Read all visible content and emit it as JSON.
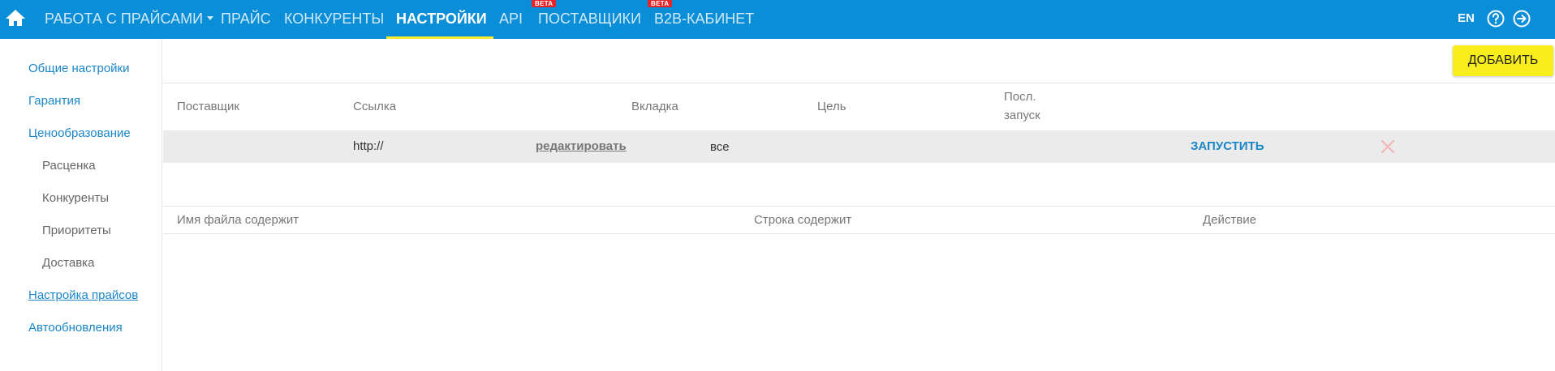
{
  "nav": {
    "items": [
      {
        "label": "РАБОТА С ПРАЙСАМИ"
      },
      {
        "label": "ПРАЙС"
      },
      {
        "label": "КОНКУРЕНТЫ"
      },
      {
        "label": "НАСТРОЙКИ"
      },
      {
        "label": "API"
      },
      {
        "label": "ПОСТАВЩИКИ"
      },
      {
        "label": "B2B-КАБИНЕТ"
      }
    ],
    "beta_label": "BETA",
    "lang": "EN"
  },
  "sidebar": {
    "items": [
      {
        "label": "Общие настройки"
      },
      {
        "label": "Гарантия"
      },
      {
        "label": "Ценообразование"
      },
      {
        "label": "Расценка"
      },
      {
        "label": "Конкуренты"
      },
      {
        "label": "Приоритеты"
      },
      {
        "label": "Доставка"
      },
      {
        "label": "Настройка прайсов"
      },
      {
        "label": "Автообновления"
      }
    ]
  },
  "toolbar": {
    "add_label": "ДОБАВИТЬ"
  },
  "table": {
    "headers": [
      "Поставщик",
      "Ссылка",
      "Вкладка",
      "Цель",
      "Посл.",
      "запуск"
    ],
    "rows": [
      {
        "supplier": "",
        "link": "http://",
        "edit": "редактировать",
        "tab": "все",
        "run": "ЗАПУСТИТЬ"
      }
    ]
  },
  "rules_table": {
    "headers": [
      "Имя файла содержит",
      "Строка содержит",
      "Действие"
    ]
  },
  "colors": {
    "topbar": "#0a8ed8",
    "accent_yellow": "#f8ee1d",
    "link_blue": "#1a86c8",
    "beta_red": "#e4262c"
  }
}
